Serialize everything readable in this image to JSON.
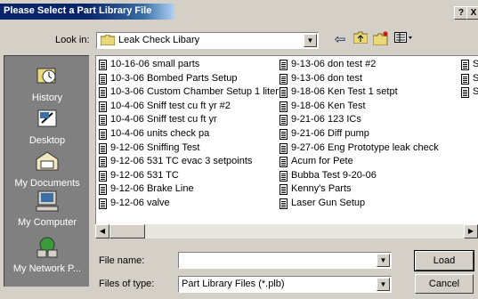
{
  "window": {
    "title": "Please Select a Part Library File",
    "help_label": "?",
    "close_label": "X"
  },
  "lookin": {
    "label": "Look in:",
    "value": "Leak Check Libary"
  },
  "places": [
    {
      "label": "History",
      "icon": "history-icon"
    },
    {
      "label": "Desktop",
      "icon": "desktop-icon"
    },
    {
      "label": "My Documents",
      "icon": "my-documents-icon"
    },
    {
      "label": "My Computer",
      "icon": "my-computer-icon"
    },
    {
      "label": "My Network P...",
      "icon": "my-network-places-icon"
    }
  ],
  "files": {
    "col1": [
      "10-16-06 small parts",
      "10-3-06 Bombed Parts Setup",
      "10-3-06 Custom Chamber Setup 1 liter",
      "10-4-06 Sniff test cu ft yr #2",
      "10-4-06 Sniff test cu ft yr",
      "10-4-06 units check pa",
      "9-12-06  Sniffing Test",
      "9-12-06 531 TC evac 3 setpoints",
      "9-12-06 531 TC",
      "9-12-06 Brake Line",
      "9-12-06 valve"
    ],
    "col2": [
      "9-13-06 don test #2",
      "9-13-06 don test",
      "9-18-06 Ken Test 1 setpt",
      "9-18-06 Ken Test",
      "9-21-06 123 ICs",
      "9-21-06 Diff pump",
      "9-27-06 Eng Prototype leak check",
      "Acum for Pete",
      "Bubba Test 9-20-06",
      "Kenny's Parts",
      "Laser Gun Setup"
    ],
    "col3": [
      "S",
      "S",
      "S"
    ]
  },
  "filename": {
    "label": "File name:",
    "value": ""
  },
  "filetype": {
    "label": "Files of type:",
    "value": "Part Library Files (*.plb)"
  },
  "buttons": {
    "load": "Load",
    "cancel": "Cancel"
  }
}
